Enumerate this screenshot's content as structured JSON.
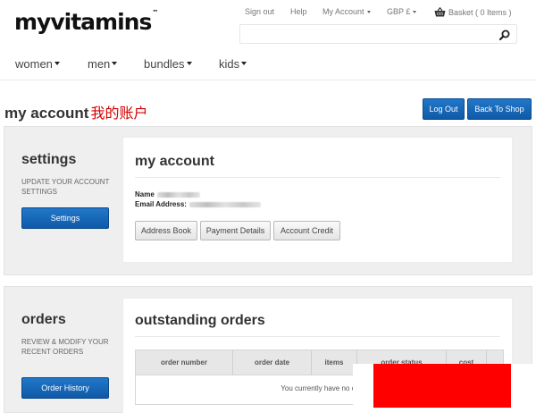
{
  "brand": {
    "logo_text": "myvitamins",
    "logo_mark": "™"
  },
  "utility_nav": {
    "sign_out": "Sign out",
    "help": "Help",
    "my_account": "My Account",
    "currency": "GBP £",
    "basket": "Basket ( 0 Items )"
  },
  "search": {
    "placeholder": "",
    "icon": "search-icon"
  },
  "main_nav": [
    {
      "label": "women"
    },
    {
      "label": "men"
    },
    {
      "label": "bundles"
    },
    {
      "label": "kids"
    }
  ],
  "page": {
    "title": "my account",
    "title_annotation": "我的账户",
    "log_out_label": "Log Out",
    "back_to_shop_label": "Back To Shop"
  },
  "settings_section": {
    "title": "settings",
    "description": "UPDATE YOUR ACCOUNT SETTINGS",
    "button_label": "Settings"
  },
  "account_card": {
    "title": "my account",
    "name_label": "Name",
    "email_label": "Email Address:",
    "buttons": [
      "Address Book",
      "Payment Details",
      "Account Credit"
    ]
  },
  "orders_section": {
    "title": "orders",
    "description": "REVIEW & MODIFY YOUR RECENT ORDERS",
    "button_label": "Order History"
  },
  "orders_card": {
    "title": "outstanding orders",
    "columns": [
      "order number",
      "order date",
      "items",
      "order status",
      "cost"
    ],
    "empty_message": "You currently have no or"
  },
  "colors": {
    "accent_blue": "#1565b5",
    "annotation_red": "#d40000",
    "redaction_red": "#ff0000",
    "panel_bg": "#efefef"
  }
}
